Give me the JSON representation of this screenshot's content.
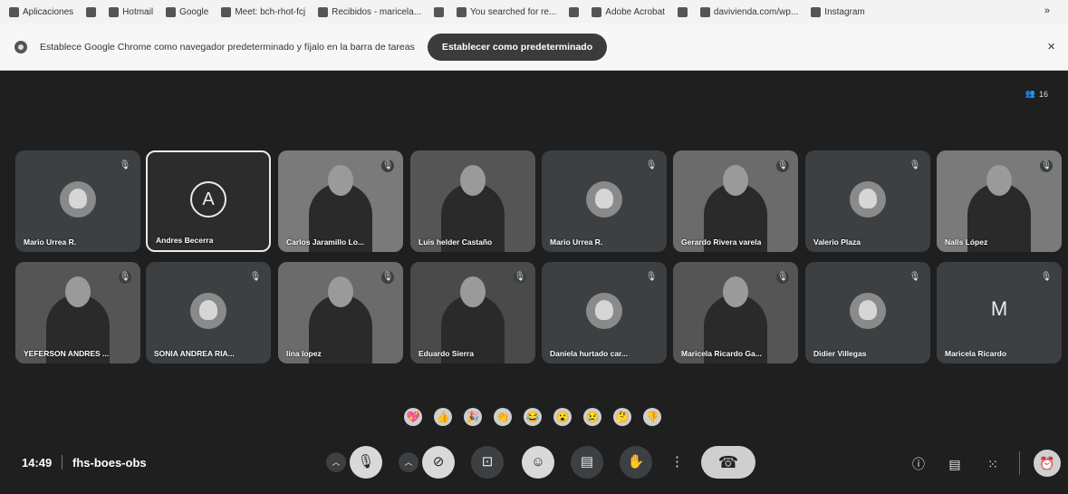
{
  "bookmarks": [
    {
      "label": "Aplicaciones",
      "icon": "apps-grid-icon"
    },
    {
      "label": "",
      "icon": "grid-icon"
    },
    {
      "label": "Hotmail",
      "icon": "hotmail-icon"
    },
    {
      "label": "Google",
      "icon": "google-icon"
    },
    {
      "label": "Meet: bch-rhot-fcj",
      "icon": "meet-icon"
    },
    {
      "label": "Recibidos - maricela...",
      "icon": "gmail-icon"
    },
    {
      "label": "",
      "icon": "globe-icon"
    },
    {
      "label": "You searched for re...",
      "icon": "bookmark-icon"
    },
    {
      "label": "",
      "icon": "gmail-icon"
    },
    {
      "label": "Adobe Acrobat",
      "icon": "acrobat-icon"
    },
    {
      "label": "",
      "icon": "google-icon"
    },
    {
      "label": "davivienda.com/wp...",
      "icon": "site-icon"
    },
    {
      "label": "Instagram",
      "icon": "instagram-icon"
    }
  ],
  "bookmarks_more": "»",
  "infobar": {
    "message": "Establece Google Chrome como navegador predeterminado y fíjalo en la barra de tareas",
    "button": "Establecer como predeterminado",
    "close": "×"
  },
  "people_count": "16",
  "tiles": [
    {
      "name": "Mario Urrea R.",
      "kind": "avatar",
      "muted": true
    },
    {
      "name": "Andres Becerra",
      "kind": "letter",
      "letter": "A",
      "muted": false,
      "selected": true
    },
    {
      "name": "Carlos Jaramillo Lo...",
      "kind": "video",
      "muted": true
    },
    {
      "name": "Luis helder Castaño",
      "kind": "video",
      "muted": false
    },
    {
      "name": "Mario Urrea R.",
      "kind": "avatar",
      "muted": true
    },
    {
      "name": "Gerardo Rivera varela",
      "kind": "video",
      "muted": true
    },
    {
      "name": "Valerio Plaza",
      "kind": "avatar",
      "muted": true
    },
    {
      "name": "Nalls López",
      "kind": "video",
      "muted": true
    },
    {
      "name": "YEFERSON ANDRES ...",
      "kind": "video",
      "muted": true
    },
    {
      "name": "SONIA ANDREA RIA...",
      "kind": "avatar",
      "muted": true
    },
    {
      "name": "lina lopez",
      "kind": "video",
      "muted": true
    },
    {
      "name": "Eduardo Sierra",
      "kind": "video",
      "muted": true
    },
    {
      "name": "Daniela hurtado car...",
      "kind": "avatar",
      "muted": true
    },
    {
      "name": "Maricela Ricardo Ga...",
      "kind": "video",
      "muted": true
    },
    {
      "name": "Didier Villegas",
      "kind": "avatar",
      "muted": true
    },
    {
      "name": "Maricela Ricardo",
      "kind": "letter",
      "letter": "M",
      "muted": true
    }
  ],
  "reactions": [
    "💖",
    "👍",
    "🎉",
    "👏",
    "😂",
    "😮",
    "😢",
    "🤔",
    "👎"
  ],
  "bottom": {
    "time": "14:49",
    "meeting_code": "fhs-boes-obs"
  }
}
